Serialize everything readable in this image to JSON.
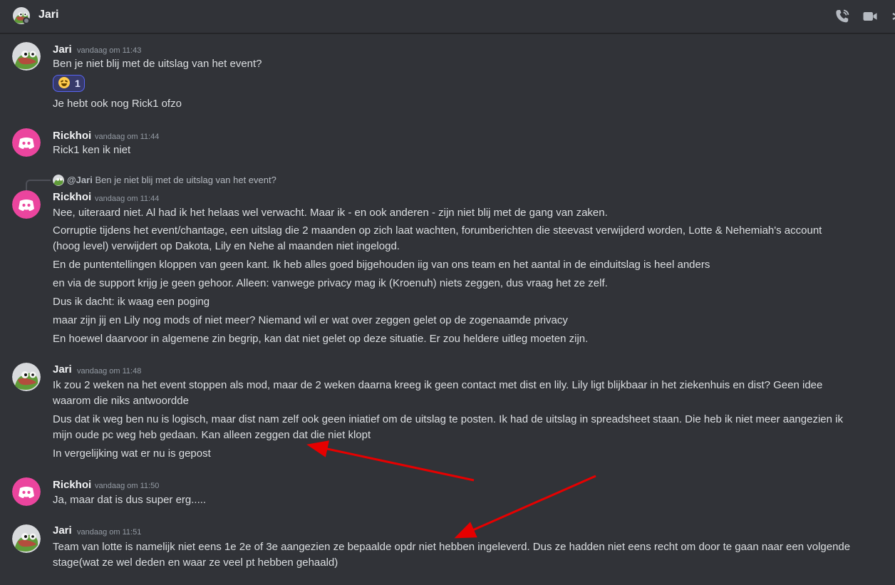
{
  "header": {
    "title": "Jari",
    "icons": [
      "call-icon",
      "video-call-icon"
    ]
  },
  "colors": {
    "background": "#313338",
    "text": "#dbdee1",
    "username": "#f2f3f5",
    "timestamp": "#949ba4",
    "rickhoi_avatar": "#eb459e",
    "reaction_border": "#5865f2",
    "annotation_arrow": "#e60000"
  },
  "messages": [
    {
      "author": "Jari",
      "timestamp": "vandaag om 11:43",
      "lines": [
        "Ben je niet blij met de uitslag van het event?"
      ],
      "reaction": {
        "emoji": "joy",
        "count": "1"
      },
      "extra_lines": [
        "Je hebt ook nog Rick1 ofzo"
      ]
    },
    {
      "author": "Rickhoi",
      "timestamp": "vandaag om 11:44",
      "lines": [
        "Rick1 ken ik niet"
      ]
    },
    {
      "reply_to": {
        "mention": "@Jari",
        "text": "Ben je niet blij met de uitslag van het event?"
      },
      "author": "Rickhoi",
      "timestamp": "vandaag om 11:44",
      "lines": [
        "Nee, uiteraard niet. Al had ik het helaas wel verwacht. Maar ik - en ook anderen - zijn niet blij met de gang van zaken.",
        "Corruptie tijdens het event/chantage, een uitslag die 2 maanden op zich laat wachten, forumberichten die steevast verwijderd worden, Lotte & Nehemiah's account",
        "(hoog level) verwijdert op Dakota, Lily en Nehe al maanden niet ingelogd.",
        "En de puntentellingen kloppen van geen kant. Ik heb alles goed bijgehouden iig van ons team en het aantal in de einduitslag is heel anders",
        "en via de support krijg je geen gehoor. Alleen: vanwege privacy mag ik (Kroenuh) niets zeggen, dus vraag het ze zelf.",
        "Dus ik dacht: ik waag een poging",
        "maar zijn jij en Lily nog mods of niet meer? Niemand wil er wat over zeggen gelet op de zogenaamde privacy",
        "En hoewel daarvoor in algemene zin begrip, kan dat niet gelet op deze situatie. Er zou heldere uitleg moeten zijn."
      ]
    },
    {
      "author": "Jari",
      "timestamp": "vandaag om 11:48",
      "lines": [
        "Ik zou 2 weken na het event stoppen als mod, maar de 2 weken daarna kreeg ik geen contact met dist en lily. Lily ligt blijkbaar in het ziekenhuis en dist? Geen idee",
        "waarom die niks antwoordde",
        "Dus dat ik weg ben nu is logisch, maar dist nam zelf ook geen iniatief om de uitslag te posten. Ik had de uitslag in spreadsheet staan. Die heb ik niet meer aangezien ik",
        "mijn oude pc weg heb gedaan. Kan alleen zeggen dat die niet klopt",
        "In vergelijking wat er nu is gepost"
      ]
    },
    {
      "author": "Rickhoi",
      "timestamp": "vandaag om 11:50",
      "lines": [
        "Ja, maar dat is dus super erg....."
      ]
    },
    {
      "author": "Jari",
      "timestamp": "vandaag om 11:51",
      "lines": [
        "Team van lotte is namelijk niet eens 1e 2e of 3e aangezien ze bepaalde opdr niet hebben ingeleverd. Dus ze hadden niet eens recht om door te gaan naar een volgende",
        "stage(wat ze wel deden en waar ze veel pt hebben gehaald)"
      ]
    }
  ]
}
